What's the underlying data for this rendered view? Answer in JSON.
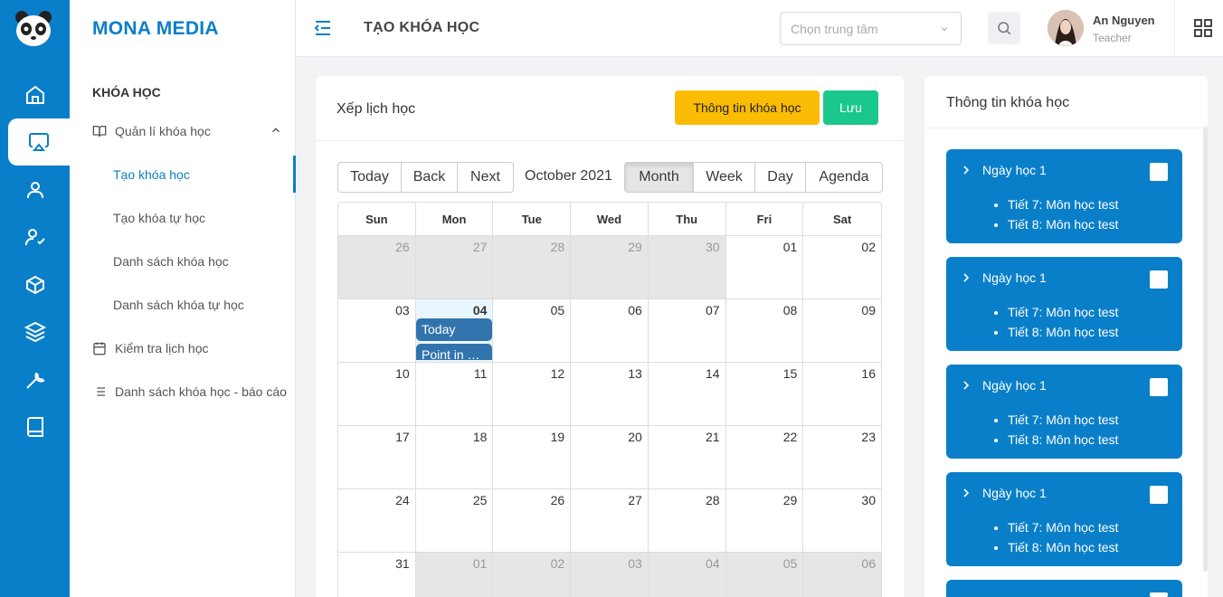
{
  "brand": "MONA MEDIA",
  "header": {
    "title": "TẠO KHÓA HỌC",
    "center_placeholder": "Chọn trung tâm",
    "user_name": "An Nguyen",
    "user_role": "Teacher"
  },
  "sidebar": {
    "section": "KHÓA HỌC",
    "groups": [
      {
        "label": "Quản lí khóa học",
        "icon": "book-open-icon"
      },
      {
        "label": "Kiểm tra lịch học",
        "icon": "calendar-icon"
      },
      {
        "label": "Danh sách khóa học - báo cáo",
        "icon": "list-icon"
      }
    ],
    "sub_items": [
      {
        "label": "Tạo khóa học",
        "active": true
      },
      {
        "label": "Tạo khóa tự học"
      },
      {
        "label": "Danh sách khóa học"
      },
      {
        "label": "Danh sách khóa tự học"
      }
    ]
  },
  "rail_icons": [
    "home-icon",
    "airplay-icon",
    "user-icon",
    "user-check-icon",
    "box-icon",
    "layers-icon",
    "tool-icon",
    "book-icon"
  ],
  "main": {
    "title": "Xếp lịch học",
    "info_button": "Thông tin khóa học",
    "save_button": "Lưu"
  },
  "calendar": {
    "nav": [
      "Today",
      "Back",
      "Next"
    ],
    "label": "October 2021",
    "views": [
      "Month",
      "Week",
      "Day",
      "Agenda"
    ],
    "active_view": "Month",
    "weekdays": [
      "Sun",
      "Mon",
      "Tue",
      "Wed",
      "Thu",
      "Fri",
      "Sat"
    ],
    "weeks": [
      [
        "26",
        "27",
        "28",
        "29",
        "30",
        "01",
        "02"
      ],
      [
        "03",
        "04",
        "05",
        "06",
        "07",
        "08",
        "09"
      ],
      [
        "10",
        "11",
        "12",
        "13",
        "14",
        "15",
        "16"
      ],
      [
        "17",
        "18",
        "19",
        "20",
        "21",
        "22",
        "23"
      ],
      [
        "24",
        "25",
        "26",
        "27",
        "28",
        "29",
        "30"
      ],
      [
        "31",
        "01",
        "02",
        "03",
        "04",
        "05",
        "06"
      ]
    ],
    "events": [
      {
        "title": "Today"
      },
      {
        "title": "Point in Time Event"
      }
    ]
  },
  "right_panel": {
    "title": "Thông tin khóa học",
    "cards": [
      {
        "day": "Ngày học 1",
        "lessons": [
          "Tiết 7: Môn học test",
          "Tiết 8: Môn học test"
        ]
      },
      {
        "day": "Ngày học 1",
        "lessons": [
          "Tiết 7: Môn học test",
          "Tiết 8: Môn học test"
        ]
      },
      {
        "day": "Ngày học 1",
        "lessons": [
          "Tiết 7: Môn học test",
          "Tiết 8: Môn học test"
        ]
      },
      {
        "day": "Ngày học 1",
        "lessons": [
          "Tiết 7: Môn học test",
          "Tiết 8: Môn học test"
        ]
      }
    ]
  },
  "colors": {
    "primary": "#0a7fc9",
    "warning": "#fbbc05",
    "success": "#1bc88b",
    "event": "#3174ad"
  }
}
